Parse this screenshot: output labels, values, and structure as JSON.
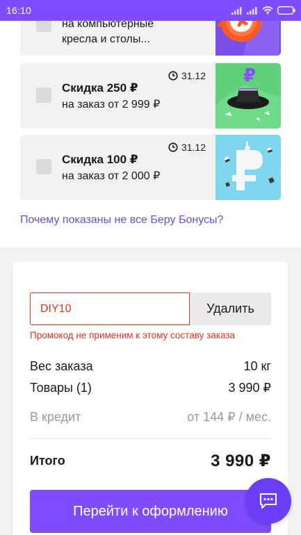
{
  "status_bar": {
    "time": "16:10",
    "icons": [
      "signal-icon",
      "signal-icon",
      "wifi-icon",
      "battery-icon"
    ]
  },
  "bonuses": [
    {
      "title": "",
      "subtitle_line1": "на компьютерные",
      "subtitle_line2": "кресла и столы...",
      "expiry": "",
      "image": "bonus-image-chair"
    },
    {
      "title": "Скидка 250 ₽",
      "subtitle": "на заказ от 2 999 ₽",
      "expiry": "31.12",
      "image": "bonus-image-hat-ruble"
    },
    {
      "title": "Скидка 100 ₽",
      "subtitle": "на заказ от 2 000 ₽",
      "expiry": "31.12",
      "image": "bonus-image-ruble-blocks"
    }
  ],
  "why_link": "Почему показаны не все Беру Бонусы?",
  "promo": {
    "value": "DIY10",
    "remove_label": "Удалить",
    "error": "Промокод не применим к этому составу заказа"
  },
  "summary": {
    "weight_label": "Вес заказа",
    "weight_value": "10 кг",
    "goods_label": "Товары (1)",
    "goods_value": "3 990 ₽",
    "credit_label": "В кредит",
    "credit_value": "от 144 ₽ / мес.",
    "total_label": "Итого",
    "total_value": "3 990 ₽"
  },
  "checkout_label": "Перейти к оформлению",
  "colors": {
    "accent": "#7f4dff",
    "error": "#e63222",
    "link": "#6b4de6"
  }
}
